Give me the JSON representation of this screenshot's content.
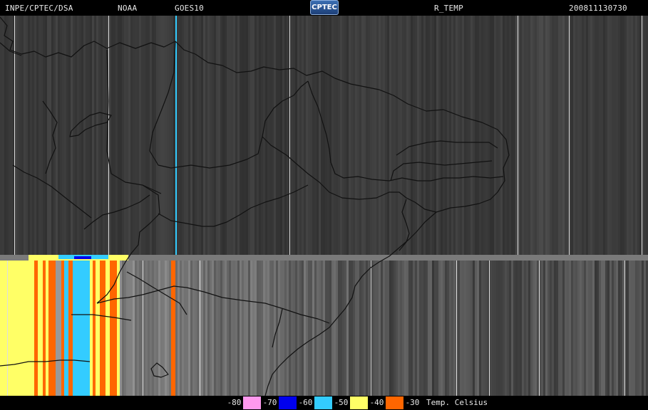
{
  "header": {
    "source": "INPE/CPTEC/DSA",
    "agency": "NOAA",
    "satellite": "GOES10",
    "logo_text": "CPTEC",
    "product": "R_TEMP",
    "timestamp": "200811130730"
  },
  "legend": {
    "steps": [
      {
        "label": "-80",
        "color": "#ff99ee"
      },
      {
        "label": "-70",
        "color": "#0000ee"
      },
      {
        "label": "-60",
        "color": "#33ccff"
      },
      {
        "label": "-50",
        "color": "#ffff66"
      },
      {
        "label": "-40",
        "color": "#ff6600"
      },
      {
        "label": "-30",
        "color": ""
      }
    ],
    "unit": "Temp. Celsius"
  }
}
